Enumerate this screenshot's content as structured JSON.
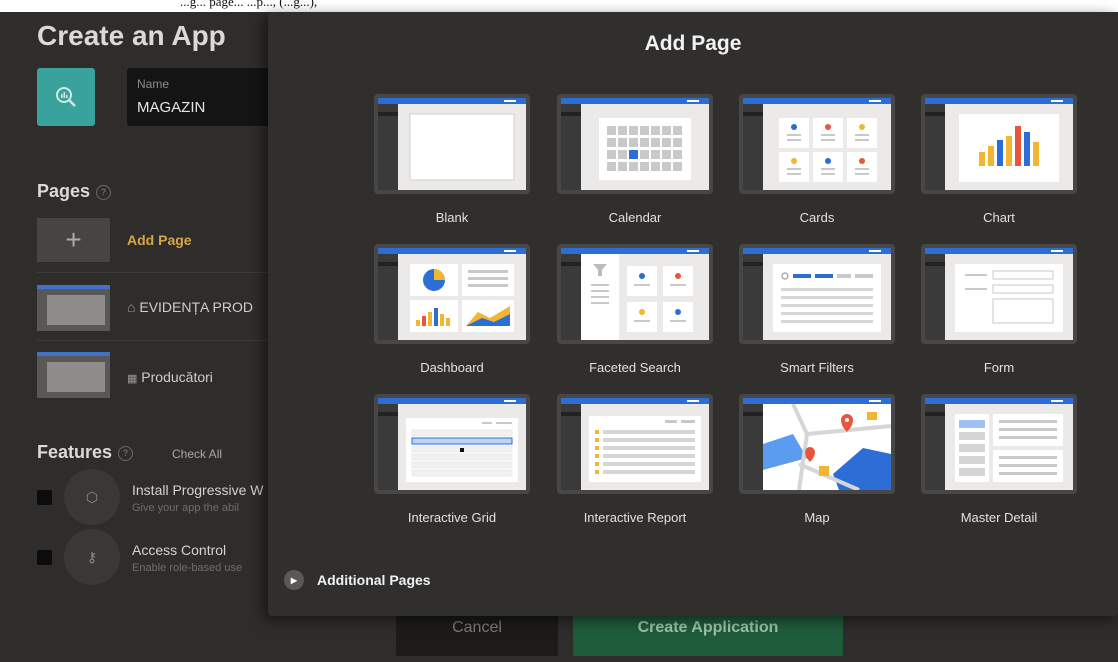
{
  "top_strip_text": "...g... page... ...p..., (...g...),",
  "background": {
    "title": "Create an App",
    "name_label": "Name",
    "name_value": "MAGAZIN",
    "pages_heading": "Pages",
    "add_page_label": "Add Page",
    "page_rows": [
      {
        "icon": "home-icon",
        "label": "EVIDENȚA PROD"
      },
      {
        "icon": "grid-icon",
        "label": "Producători"
      }
    ],
    "features_heading": "Features",
    "check_all": "Check All",
    "features": [
      {
        "title": "Install Progressive W",
        "desc": "Give your app the abil",
        "icon": "package-icon"
      },
      {
        "title": "Access Control",
        "desc": "Enable role-based use",
        "icon": "key-icon"
      }
    ],
    "cancel_label": "Cancel",
    "create_label": "Create Application"
  },
  "modal": {
    "title": "Add Page",
    "tiles": [
      {
        "label": "Blank",
        "kind": "blank"
      },
      {
        "label": "Calendar",
        "kind": "calendar"
      },
      {
        "label": "Cards",
        "kind": "cards"
      },
      {
        "label": "Chart",
        "kind": "chart"
      },
      {
        "label": "Dashboard",
        "kind": "dashboard"
      },
      {
        "label": "Faceted Search",
        "kind": "faceted"
      },
      {
        "label": "Smart Filters",
        "kind": "smart"
      },
      {
        "label": "Form",
        "kind": "form"
      },
      {
        "label": "Interactive Grid",
        "kind": "grid"
      },
      {
        "label": "Interactive Report",
        "kind": "report"
      },
      {
        "label": "Map",
        "kind": "map"
      },
      {
        "label": "Master Detail",
        "kind": "master"
      }
    ],
    "additional_pages": "Additional Pages"
  },
  "colors": {
    "accent_blue": "#2d6ed6",
    "link_gold": "#d8a643",
    "app_teal": "#3aa29c",
    "create_green": "#1f5c3b"
  }
}
